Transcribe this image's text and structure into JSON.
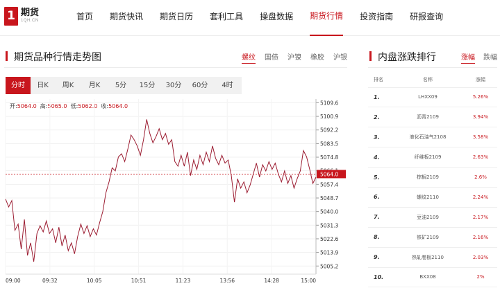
{
  "header": {
    "logo_mark": "1",
    "logo_name": "期货",
    "logo_sub": "1QH.CN",
    "nav": [
      {
        "label": "首页",
        "active": false
      },
      {
        "label": "期货快讯",
        "active": false
      },
      {
        "label": "期货日历",
        "active": false
      },
      {
        "label": "套利工具",
        "active": false
      },
      {
        "label": "操盘数据",
        "active": false
      },
      {
        "label": "期货行情",
        "active": true
      },
      {
        "label": "投资指南",
        "active": false
      },
      {
        "label": "研报查询",
        "active": false
      }
    ]
  },
  "trend": {
    "title": "期货品种行情走势图",
    "varieties": [
      {
        "label": "螺纹",
        "active": true
      },
      {
        "label": "国债",
        "active": false
      },
      {
        "label": "沪镍",
        "active": false
      },
      {
        "label": "橡胶",
        "active": false
      },
      {
        "label": "沪银",
        "active": false
      }
    ],
    "periods": [
      {
        "label": "分时",
        "active": true
      },
      {
        "label": "日K",
        "active": false
      },
      {
        "label": "周K",
        "active": false
      },
      {
        "label": "月K",
        "active": false
      },
      {
        "label": "5分",
        "active": false
      },
      {
        "label": "15分",
        "active": false
      },
      {
        "label": "30分",
        "active": false
      },
      {
        "label": "60分",
        "active": false
      },
      {
        "label": "4时",
        "active": false
      }
    ],
    "ohlc": {
      "open_label": "开:",
      "open": "5064.0",
      "high_label": "高:",
      "high": "5065.0",
      "low_label": "低:",
      "low": "5062.0",
      "close_label": "收:",
      "close": "5064.0"
    }
  },
  "chart_data": {
    "type": "line",
    "ylim": [
      5000,
      5112
    ],
    "yticks": [
      "5109.6",
      "5100.9",
      "5092.2",
      "5083.5",
      "5074.8",
      "5066.1",
      "5057.4",
      "5048.7",
      "5040.0",
      "5031.3",
      "5022.6",
      "5013.9",
      "5005.2"
    ],
    "xticks": [
      "09:00",
      "09:32",
      "10:05",
      "10:51",
      "11:23",
      "13:56",
      "14:28",
      "15:00"
    ],
    "current_price": "5064.0",
    "line_color": "#9b1b30",
    "accent_color": "#c8161d",
    "series": [
      {
        "values": [
          5048,
          5043,
          5047,
          5028,
          5032,
          5016,
          5035,
          5012,
          5020,
          5008,
          5026,
          5031,
          5027,
          5034,
          5026,
          5029,
          5020,
          5030,
          5018,
          5025,
          5015,
          5020,
          5013,
          5024,
          5032,
          5026,
          5031,
          5024,
          5029,
          5025,
          5033,
          5040,
          5052,
          5059,
          5068,
          5066,
          5075,
          5077,
          5072,
          5080,
          5089,
          5086,
          5082,
          5076,
          5086,
          5099,
          5090,
          5084,
          5088,
          5093,
          5086,
          5090,
          5083,
          5086,
          5072,
          5069,
          5076,
          5069,
          5078,
          5063,
          5073,
          5067,
          5076,
          5070,
          5078,
          5072,
          5082,
          5074,
          5070,
          5076,
          5071,
          5073,
          5063,
          5046,
          5061,
          5055,
          5059,
          5052,
          5057,
          5064,
          5071,
          5062,
          5070,
          5066,
          5072,
          5067,
          5071,
          5064,
          5059,
          5066,
          5058,
          5063,
          5055,
          5061,
          5066,
          5079,
          5075,
          5067,
          5058,
          5062
        ]
      }
    ]
  },
  "ranking": {
    "title": "内盘涨跌排行",
    "tabs": [
      {
        "label": "涨幅",
        "active": true
      },
      {
        "label": "跌幅",
        "active": false
      }
    ],
    "headers": [
      "排名",
      "名称",
      "涨幅"
    ],
    "rows": [
      {
        "rank": "1.",
        "name": "LHXX09",
        "change": "5.26%"
      },
      {
        "rank": "2.",
        "name": "沥青2109",
        "change": "3.94%"
      },
      {
        "rank": "3.",
        "name": "液化石油气2108",
        "change": "3.58%"
      },
      {
        "rank": "4.",
        "name": "纤维板2109",
        "change": "2.63%"
      },
      {
        "rank": "5.",
        "name": "棕榈2109",
        "change": "2.6%"
      },
      {
        "rank": "6.",
        "name": "螺纹2110",
        "change": "2.24%"
      },
      {
        "rank": "7.",
        "name": "豆油2109",
        "change": "2.17%"
      },
      {
        "rank": "8.",
        "name": "铁矿2109",
        "change": "2.16%"
      },
      {
        "rank": "9.",
        "name": "热轧卷板2110",
        "change": "2.03%"
      },
      {
        "rank": "10.",
        "name": "BXX08",
        "change": "2%"
      }
    ]
  }
}
